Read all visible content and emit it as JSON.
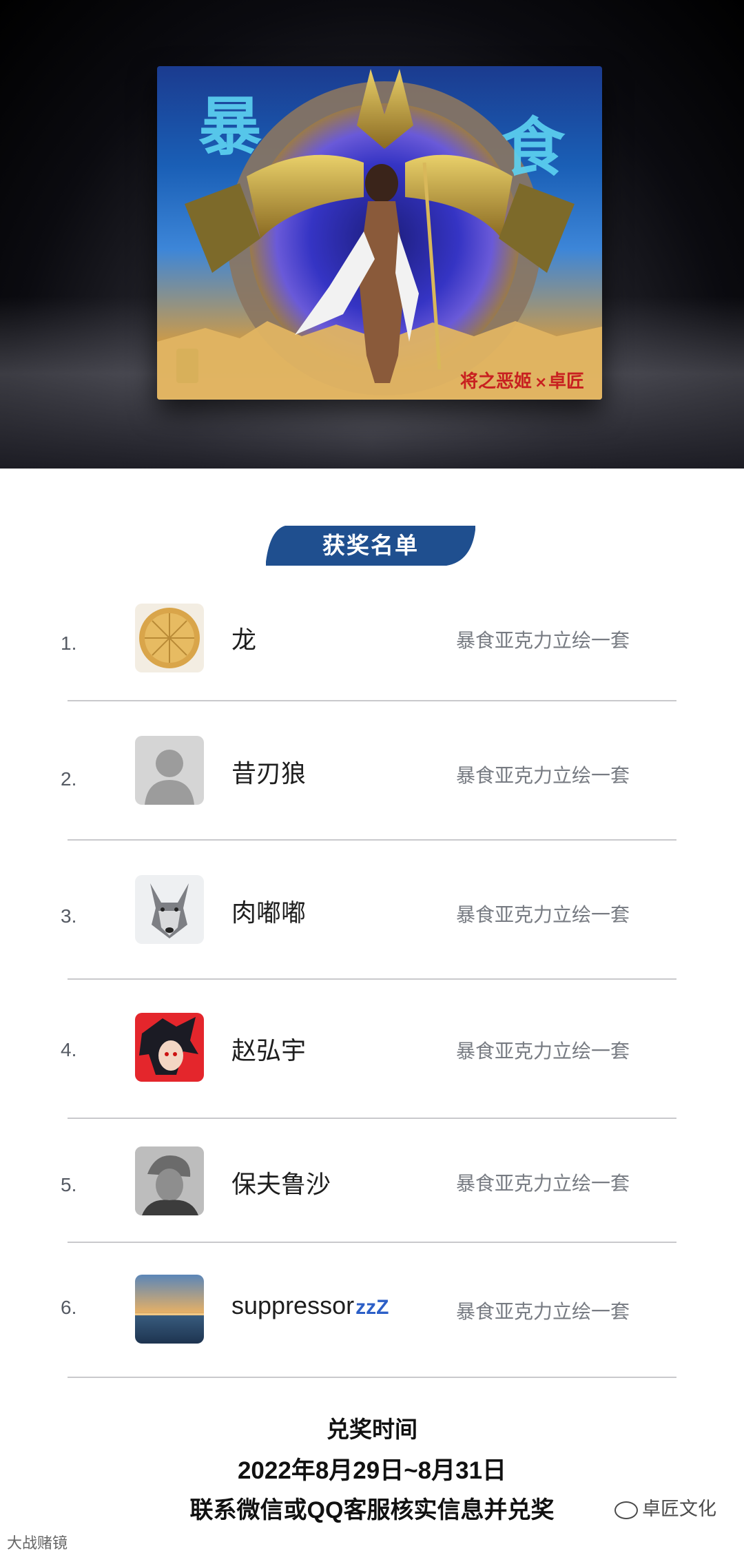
{
  "hero": {
    "art_title_chars": [
      "暴",
      "食"
    ],
    "brand_logos": [
      "将之恶姬",
      "×",
      "卓匠"
    ],
    "colors": {
      "backdrop": "#0b0b10",
      "art_sky": "#1a5fb6",
      "art_sand": "#e6b867"
    }
  },
  "winners_badge": {
    "label": "获奖名单",
    "color": "#1f4f8f"
  },
  "winners": [
    {
      "rank": "1.",
      "name": "龙",
      "prize": "暴食亚克力立绘一套",
      "avatar_icon": "pizza-avatar-icon"
    },
    {
      "rank": "2.",
      "name": "昔刃狼",
      "prize": "暴食亚克力立绘一套",
      "avatar_icon": "default-person-avatar-icon"
    },
    {
      "rank": "3.",
      "name": "肉嘟嘟",
      "prize": "暴食亚克力立绘一套",
      "avatar_icon": "wolf-avatar-icon"
    },
    {
      "rank": "4.",
      "name": "赵弘宇",
      "prize": "暴食亚克力立绘一套",
      "avatar_icon": "anime-avatar-icon"
    },
    {
      "rank": "5.",
      "name": "保夫鲁沙",
      "prize": "暴食亚克力立绘一套",
      "avatar_icon": "soldier-avatar-icon"
    },
    {
      "rank": "6.",
      "name": "suppressor",
      "name_suffix": "zzZ",
      "prize": "暴食亚克力立绘一套",
      "avatar_icon": "sunset-avatar-icon"
    }
  ],
  "redeem": {
    "title": "兑奖时间",
    "dates": "2022年8月29日~8月31日",
    "instructions": "联系微信或QQ客服核实信息并兑奖"
  },
  "watermarks": {
    "right": "卓匠文化",
    "left": "大战赌镜"
  }
}
